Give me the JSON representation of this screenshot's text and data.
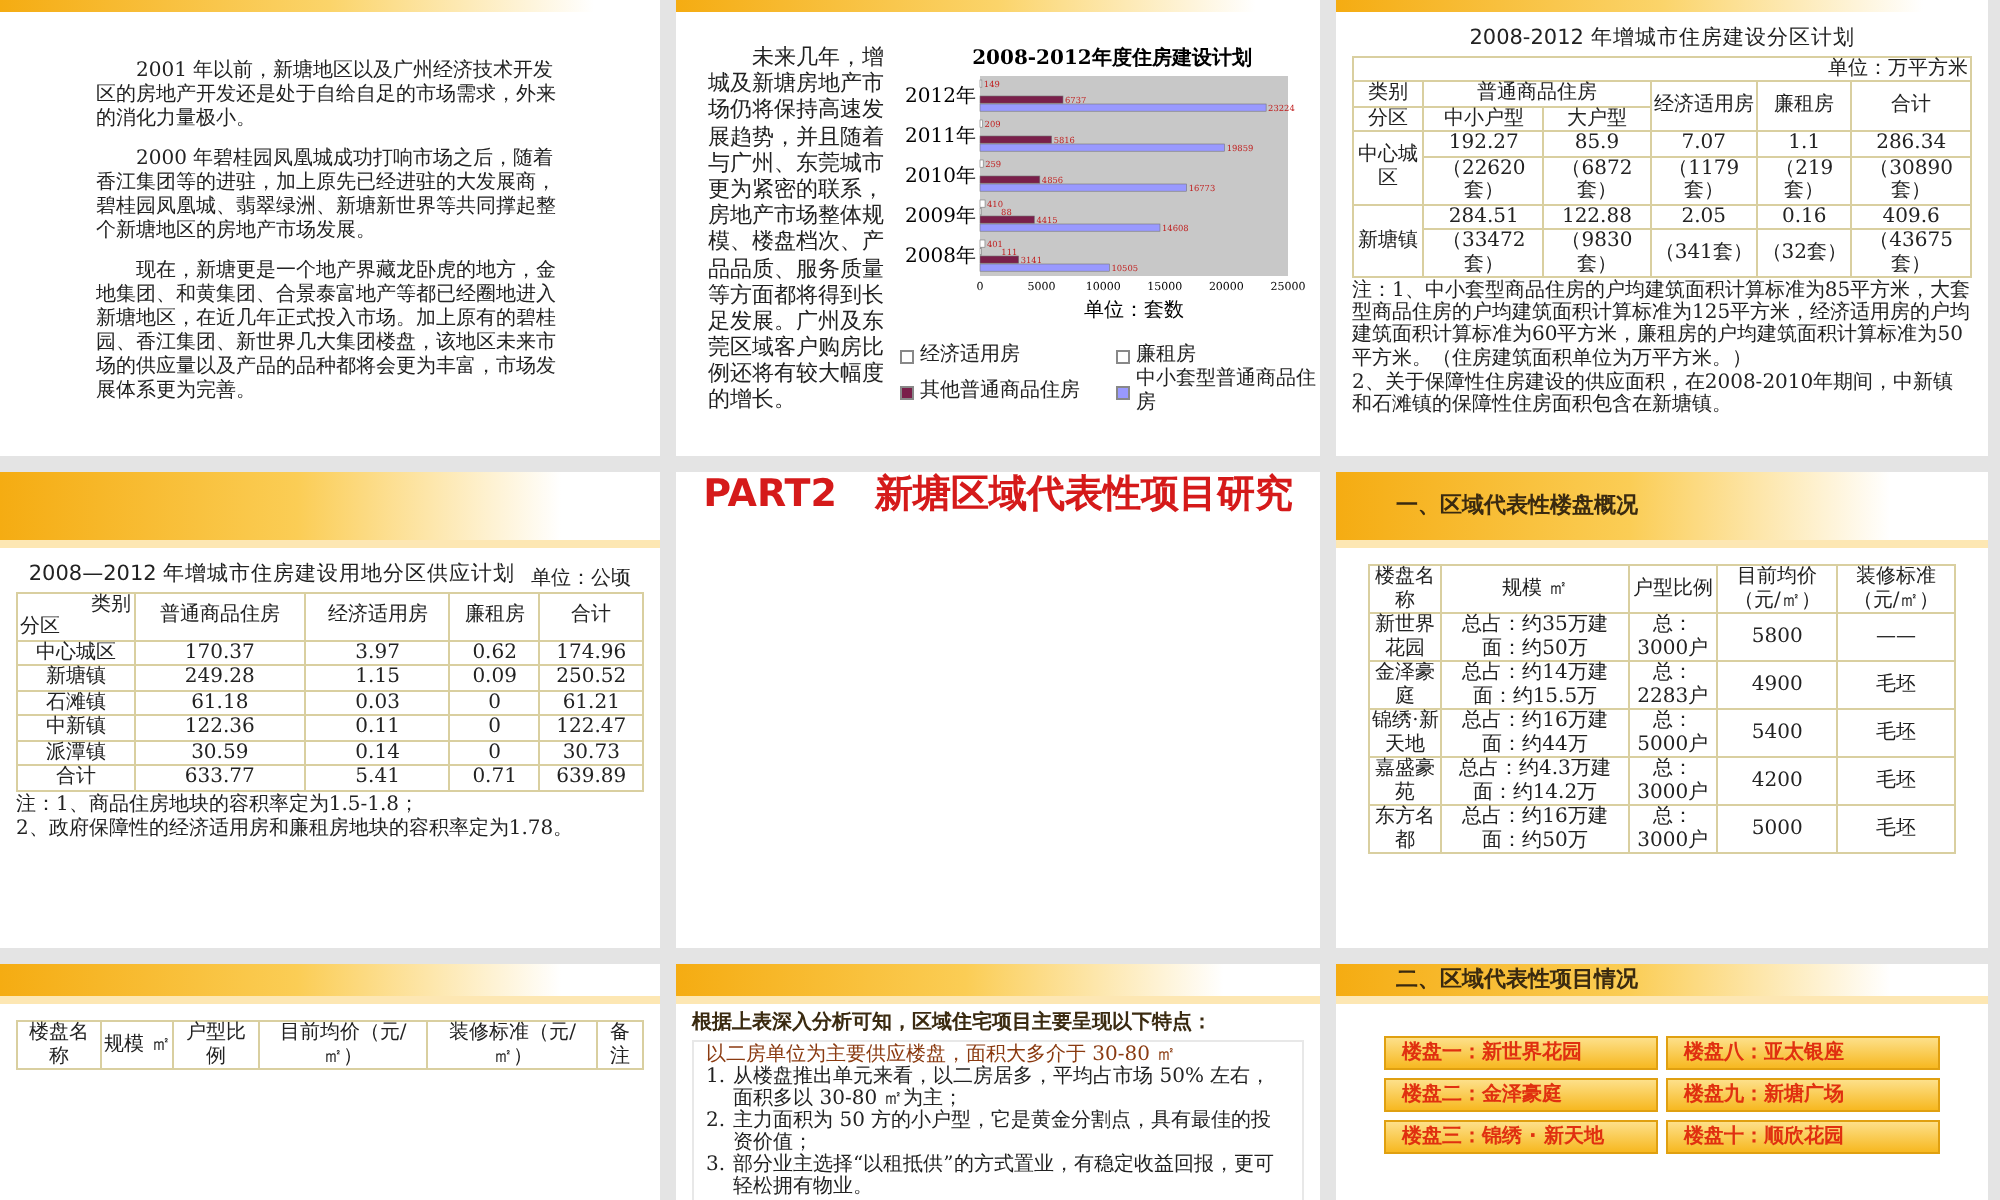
{
  "slides": [
    {
      "kind": "text",
      "paragraphs": [
        "2001 年以前，新塘地区以及广州经济技术开发区的房地产开发还是处于自给自足的市场需求，外来的消化力量极小。",
        "2000 年碧桂园凤凰城成功打响市场之后，随着香江集团等的进驻，加上原先已经进驻的大发展商，碧桂园凤凰城、翡翠绿洲、新塘新世界等共同撑起整个新塘地区的房地产市场发展。",
        "现在，新塘更是一个地产界藏龙卧虎的地方，金地集团、和黄集团、合景泰富地产等都已经圈地进入新塘地区，在近几年正式投入市场。加上原有的碧桂园、香江集团、新世界几大集团楼盘，该地区未来市场的供应量以及产品的品种都将会更为丰富，市场发展体系更为完善。"
      ]
    },
    {
      "kind": "chart",
      "text": "未来几年，增城及新塘房地产市场仍将保持高速发展趋势，并且随着与广州、东莞城市更为紧密的联系，房地产市场整体规模、楼盘档次、产品品质、服务质量等方面都将得到长足发展。广州及东莞区域客户购房比例还将有较大幅度的增长。",
      "chart_data": {
        "type": "bar",
        "orientation": "horizontal",
        "title": "2008-2012年度住房建设计划",
        "xlabel": "单位：套数",
        "categories": [
          "2012年",
          "2011年",
          "2010年",
          "2009年",
          "2008年"
        ],
        "xlim": [
          0,
          25000
        ],
        "xticks": [
          0,
          5000,
          10000,
          15000,
          20000,
          25000
        ],
        "data_labels": true,
        "legend": "bottom",
        "series": [
          {
            "name": "经济适用房",
            "color": "#ffffff",
            "values": [
              149,
              209,
              259,
              410,
              401
            ]
          },
          {
            "name": "廉租房",
            "color": "#ffffff",
            "values": [
              null,
              null,
              null,
              88,
              111
            ]
          },
          {
            "name": "其他普通商品住房",
            "color": "#7a1f4a",
            "values": [
              6737,
              5816,
              4856,
              4415,
              3141
            ]
          },
          {
            "name": "中小套型普通商品住房",
            "color": "#9999ff",
            "values": [
              23224,
              19859,
              16773,
              14608,
              10505
            ]
          }
        ]
      }
    },
    {
      "kind": "table",
      "title": "2008-2012 年增城市住房建设分区计划",
      "unit": "单位：万平方米",
      "rows": [
        [
          "类别",
          {
            "text": "普通商品住房",
            "colspan": 2
          },
          {
            "text": "经济适用房",
            "rowspan": 2
          },
          {
            "text": "廉租房",
            "rowspan": 2
          },
          {
            "text": "合计",
            "rowspan": 2
          }
        ],
        [
          "分区",
          "中小户型",
          "大户型"
        ],
        [
          {
            "text": "中心城区",
            "rowspan": 2
          },
          "192.27",
          "85.9",
          "7.07",
          "1.1",
          "286.34"
        ],
        [
          "（22620套）",
          "（6872套）",
          "（1179套）",
          "（219套）",
          "（30890套）"
        ],
        [
          {
            "text": "新塘镇",
            "rowspan": 2
          },
          "284.51",
          "122.88",
          "2.05",
          "0.16",
          "409.6"
        ],
        [
          "（33472套）",
          "（9830套）",
          "（341套）",
          "（32套）",
          "（43675套）"
        ]
      ],
      "notes": [
        "注：1、中小套型商品住房的户均建筑面积计算标准为85平方米，大套型商品住房的户均建筑面积计算标准为125平方米，经济适用房的户均建筑面积计算标准为60平方米，廉租房的户均建筑面积计算标准为50平方米。（住房建筑面积单位为万平方米。）",
        "2、关于保障性住房建设的供应面积，在2008-2010年期间，中新镇和石滩镇的保障性住房面积包含在新塘镇。"
      ]
    },
    {
      "kind": "table",
      "title": "2008—2012 年增城市住房建设用地分区供应计划",
      "unit": "单位：公顷",
      "rows": [
        [
          {
            "text": "类别",
            "sub": "分区"
          },
          "普通商品住房",
          "经济适用房",
          "廉租房",
          "合计"
        ],
        [
          "中心城区",
          "170.37",
          "3.97",
          "0.62",
          "174.96"
        ],
        [
          "新塘镇",
          "249.28",
          "1.15",
          "0.09",
          "250.52"
        ],
        [
          "石滩镇",
          "61.18",
          "0.03",
          "0",
          "61.21"
        ],
        [
          "中新镇",
          "122.36",
          "0.11",
          "0",
          "122.47"
        ],
        [
          "派潭镇",
          "30.59",
          "0.14",
          "0",
          "30.73"
        ],
        [
          "合计",
          "633.77",
          "5.41",
          "0.71",
          "639.89"
        ]
      ],
      "notes": [
        "注：1、商品住房地块的容积率定为1.5-1.8；",
        "2、政府保障性的经济适用房和廉租房地块的容积率定为1.78。"
      ]
    },
    {
      "kind": "title",
      "title": "PART2　新塘区域代表性项目研究"
    },
    {
      "kind": "table",
      "heading": "一、区域代表性楼盘概况",
      "rows": [
        [
          "楼盘名称",
          "规模 ㎡",
          "户型比例",
          "目前均价（元/㎡）",
          "装修标准（元/㎡）"
        ],
        [
          "新世界花园",
          "总占：约35万建面：约50万",
          "总：3000户",
          "5800",
          "——"
        ],
        [
          "金泽豪庭",
          "总占：约14万建面：约15.5万",
          "总：2283户",
          "4900",
          "毛坯"
        ],
        [
          "锦绣·新天地",
          "总占：约16万建面：约44万",
          "总：5000户",
          "5400",
          "毛坯"
        ],
        [
          "嘉盛豪苑",
          "总占：约4.3万建面：约14.2万",
          "总：3000户",
          "4200",
          "毛坯"
        ],
        [
          "东方名都",
          "总占：约16万建面：约50万",
          "总：3000户",
          "5000",
          "毛坯"
        ]
      ]
    },
    {
      "kind": "table",
      "rows": [
        [
          "楼盘名称",
          "规模 ㎡",
          "户型比例",
          "目前均价（元/㎡）",
          "装修标准（元/㎡）",
          "备注"
        ]
      ]
    },
    {
      "kind": "list",
      "heading": "根据上表深入分析可知，区域住宅项目主要呈现以下特点：",
      "groups": [
        {
          "title": "以二房单位为主要供应楼盘，面积大多介于 30-80 ㎡",
          "items": [
            {
              "num": "1.",
              "text": "从楼盘推出单元来看，以二房居多，平均占市场 50% 左右，面积多以 30-80 ㎡为主；"
            },
            {
              "num": "2.",
              "text": "主力面积为 50 方的小户型，它是黄金分割点，具有最佳的投资价值；"
            },
            {
              "num": "3.",
              "text": "部分业主选择“以租抵供”的方式置业，有稳定收益回报，更可轻松拥有物业。"
            }
          ]
        }
      ]
    },
    {
      "kind": "buttons",
      "heading": "二、区域代表性项目情况",
      "projects": [
        "楼盘一：新世界花园",
        "楼盘八：亚太银座",
        "楼盘二：金泽豪庭",
        "楼盘九：新塘广场",
        "楼盘三：锦绣 · 新天地",
        "楼盘十：顺欣花园"
      ]
    }
  ]
}
